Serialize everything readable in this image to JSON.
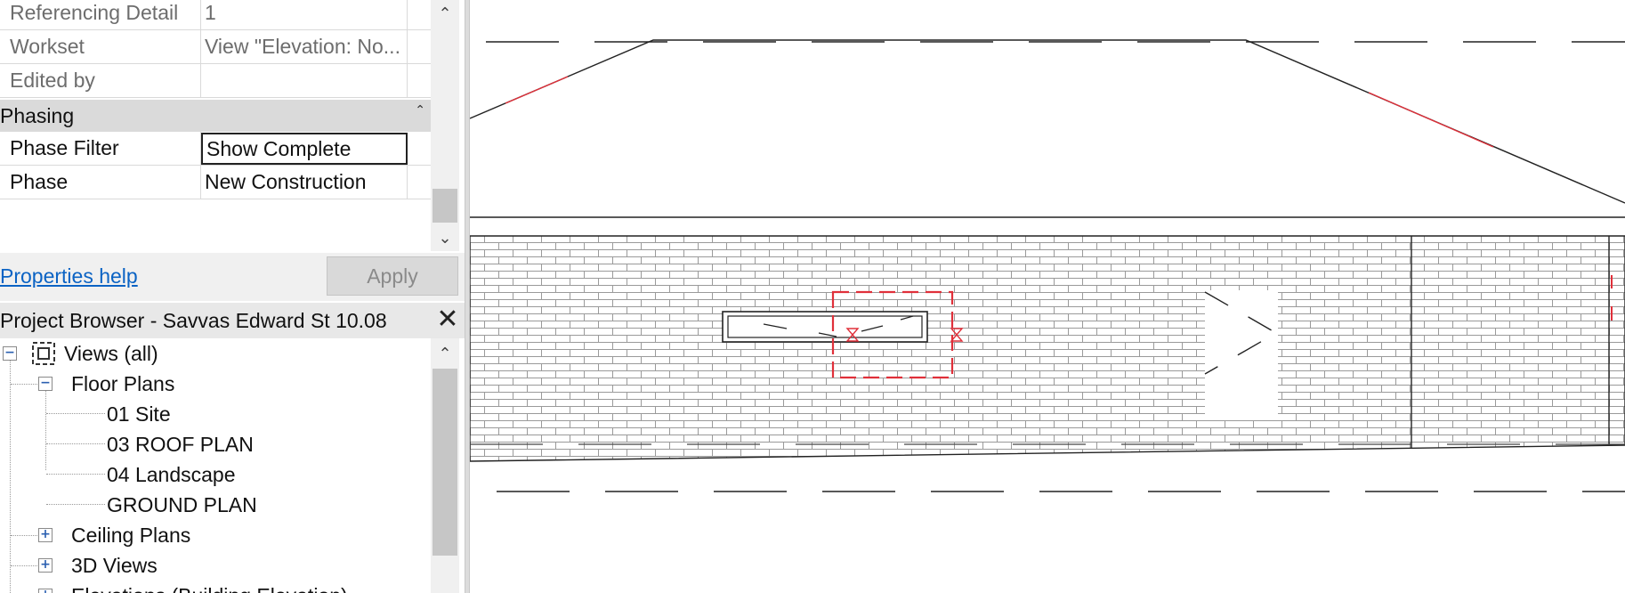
{
  "properties": {
    "rows": [
      {
        "name": "Referencing Detail",
        "value": "1"
      },
      {
        "name": "Workset",
        "value": "View \"Elevation: No..."
      },
      {
        "name": "Edited by",
        "value": ""
      }
    ],
    "phasing_section": "Phasing",
    "phasing_rows": [
      {
        "name": "Phase Filter",
        "value": "Show Complete"
      },
      {
        "name": "Phase",
        "value": "New Construction"
      }
    ],
    "help_link": "Properties help",
    "apply_label": "Apply"
  },
  "project_browser": {
    "title": "Project Browser - Savvas Edward St 10.08",
    "close_glyph": "✕",
    "tree": {
      "root": "Views (all)",
      "floor_plans": "Floor Plans",
      "floor_plan_items": [
        "01 Site",
        "03 ROOF PLAN",
        "04 Landscape",
        "GROUND PLAN"
      ],
      "ceiling_plans": "Ceiling Plans",
      "views_3d": "3D Views",
      "elevations": "Elevations (Building Elevation)"
    }
  },
  "glyphs": {
    "collapse": "−",
    "expand": "+",
    "scroll_up": "⌃",
    "scroll_down": "⌄",
    "section_collapse": "⌃"
  },
  "colors": {
    "link": "#0b63c4",
    "selection_red": "#e0303a",
    "header_gray": "#dadada"
  }
}
